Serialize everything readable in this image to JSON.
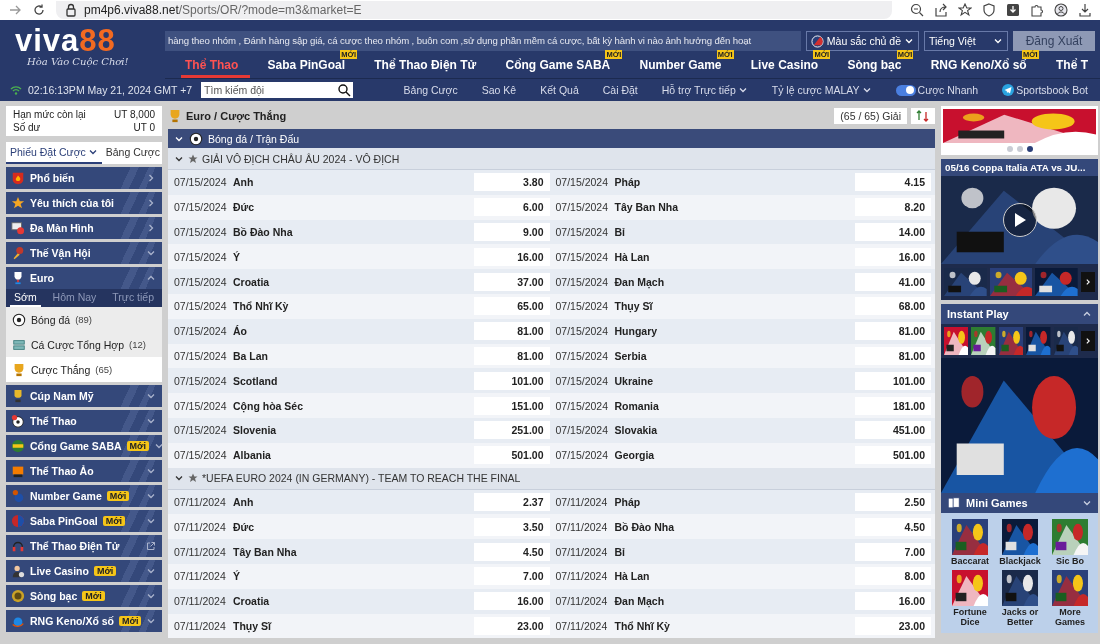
{
  "browser": {
    "url_host": "pm4p6.viva88.net",
    "url_path": "/Sports/OR/?mode=m3&market=E"
  },
  "header": {
    "logo": {
      "name": "viva",
      "number": "88",
      "tagline": "Hòa Vào Cuộc Chơi!"
    },
    "ticker": "hàng theo nhóm , Đánh hàng sập giá, cá cược theo nhóm , buôn com ,sử dụng phần mềm cá cược, bất kỳ hành vi nào ảnh hưởng đến hoạt",
    "theme_button": "Màu sắc chủ đề",
    "language": "Tiếng Việt",
    "logout": "Đăng Xuất",
    "nav": [
      {
        "label": "Thể Thao",
        "selected": true
      },
      {
        "label": "Saba PinGoal",
        "selected": false,
        "badge": "MỚI"
      },
      {
        "label": "Thể Thao Điện Tử",
        "selected": false
      },
      {
        "label": "Cổng Game SABA",
        "selected": false,
        "badge": "MỚI"
      },
      {
        "label": "Number Game",
        "selected": false,
        "badge": "MỚI"
      },
      {
        "label": "Live Casino",
        "selected": false,
        "badge": "MỚI"
      },
      {
        "label": "Sòng bạc",
        "selected": false,
        "badge": "MỚI"
      },
      {
        "label": "RNG Keno/Xổ số",
        "selected": false,
        "badge": "MỚI"
      },
      {
        "label": "Thể T",
        "selected": false
      }
    ]
  },
  "toolbar": {
    "clock": "02:16:13PM May 21, 2024 GMT +7",
    "search_placeholder": "Tìm kiếm đội",
    "links": [
      {
        "label": "Bảng Cược",
        "dropdown": false
      },
      {
        "label": "Sao Kê",
        "dropdown": false
      },
      {
        "label": "Kết Quả",
        "dropdown": false
      },
      {
        "label": "Cài Đặt",
        "dropdown": false
      },
      {
        "label": "Hỗ trợ Trực tiếp",
        "dropdown": true
      },
      {
        "label": "Tỷ lệ cược MALAY",
        "dropdown": true
      }
    ],
    "quick_bet": {
      "label": "Cược Nhanh",
      "on": true
    },
    "bot": "Sportsbook Bot"
  },
  "sidebar": {
    "balance": [
      {
        "label": "Hạn mức còn lại",
        "value": "UT 8,000"
      },
      {
        "label": "Số dư",
        "value": "UT 0"
      }
    ],
    "tabs": [
      {
        "label": "Phiếu Đặt Cược",
        "selected": true,
        "dropdown": true
      },
      {
        "label": "Bảng Cược",
        "selected": false,
        "dropdown": false
      }
    ],
    "menu": [
      {
        "label": "Phổ biến",
        "kind": "link"
      },
      {
        "label": "Yêu thích của tôi",
        "kind": "link"
      },
      {
        "label": "Đa Màn Hình",
        "kind": "link"
      },
      {
        "label": "Thế Vận Hội",
        "kind": "group",
        "expanded": false
      },
      {
        "label": "Euro",
        "kind": "group",
        "expanded": true,
        "subtabs": [
          {
            "label": "Sớm",
            "selected": true
          },
          {
            "label": "Hôm Nay",
            "selected": false
          },
          {
            "label": "Trực tiếp",
            "selected": false
          }
        ],
        "children": [
          {
            "label": "Bóng đá",
            "count": "(89)",
            "selected": false
          },
          {
            "label": "Cá Cược Tổng Hợp",
            "count": "(12)",
            "selected": false
          },
          {
            "label": "Cược Thắng",
            "count": "(65)",
            "selected": true
          }
        ]
      },
      {
        "label": "Cúp Nam Mỹ",
        "kind": "group",
        "expanded": false
      },
      {
        "label": "Thể Thao",
        "kind": "group",
        "expanded": false
      },
      {
        "label": "Cổng Game SABA",
        "kind": "group",
        "expanded": false,
        "badge": "Mới"
      },
      {
        "label": "Thể Thao Ảo",
        "kind": "group",
        "expanded": false
      },
      {
        "label": "Number Game",
        "kind": "group",
        "expanded": false,
        "badge": "Mới"
      },
      {
        "label": "Saba PinGoal",
        "kind": "group",
        "expanded": false,
        "badge": "Mới"
      },
      {
        "label": "Thể Thao Điện Tử",
        "kind": "external"
      },
      {
        "label": "Live Casino",
        "kind": "group",
        "expanded": false,
        "badge": "Mới"
      },
      {
        "label": "Sòng bạc",
        "kind": "group",
        "expanded": false,
        "badge": "Mới"
      },
      {
        "label": "RNG Keno/Xổ số",
        "kind": "group",
        "expanded": false,
        "badge": "Mới"
      }
    ]
  },
  "main": {
    "breadcrumb": "Euro / Cược Thắng",
    "league_count": "(65 / 65) Giải",
    "sport_header": "Bóng đá / Trận Đấu",
    "groups": [
      {
        "title": "GIẢI VÔ ĐỊCH CHÂU ÂU 2024 - VÔ ĐỊCH",
        "rows": [
          {
            "left": {
              "date": "07/15/2024",
              "team": "Anh",
              "odds": "3.80"
            },
            "right": {
              "date": "07/15/2024",
              "team": "Pháp",
              "odds": "4.15"
            }
          },
          {
            "left": {
              "date": "07/15/2024",
              "team": "Đức",
              "odds": "6.00"
            },
            "right": {
              "date": "07/15/2024",
              "team": "Tây Ban Nha",
              "odds": "8.20"
            }
          },
          {
            "left": {
              "date": "07/15/2024",
              "team": "Bồ Đào Nha",
              "odds": "9.00"
            },
            "right": {
              "date": "07/15/2024",
              "team": "Bỉ",
              "odds": "14.00"
            }
          },
          {
            "left": {
              "date": "07/15/2024",
              "team": "Ý",
              "odds": "16.00"
            },
            "right": {
              "date": "07/15/2024",
              "team": "Hà Lan",
              "odds": "16.00"
            }
          },
          {
            "left": {
              "date": "07/15/2024",
              "team": "Croatia",
              "odds": "37.00"
            },
            "right": {
              "date": "07/15/2024",
              "team": "Đan Mạch",
              "odds": "41.00"
            }
          },
          {
            "left": {
              "date": "07/15/2024",
              "team": "Thổ Nhĩ Kỳ",
              "odds": "65.00"
            },
            "right": {
              "date": "07/15/2024",
              "team": "Thụy Sĩ",
              "odds": "68.00"
            }
          },
          {
            "left": {
              "date": "07/15/2024",
              "team": "Áo",
              "odds": "81.00"
            },
            "right": {
              "date": "07/15/2024",
              "team": "Hungary",
              "odds": "81.00"
            }
          },
          {
            "left": {
              "date": "07/15/2024",
              "team": "Ba Lan",
              "odds": "81.00"
            },
            "right": {
              "date": "07/15/2024",
              "team": "Serbia",
              "odds": "81.00"
            }
          },
          {
            "left": {
              "date": "07/15/2024",
              "team": "Scotland",
              "odds": "101.00"
            },
            "right": {
              "date": "07/15/2024",
              "team": "Ukraine",
              "odds": "101.00"
            }
          },
          {
            "left": {
              "date": "07/15/2024",
              "team": "Cộng hòa Séc",
              "odds": "151.00"
            },
            "right": {
              "date": "07/15/2024",
              "team": "Romania",
              "odds": "181.00"
            }
          },
          {
            "left": {
              "date": "07/15/2024",
              "team": "Slovenia",
              "odds": "251.00"
            },
            "right": {
              "date": "07/15/2024",
              "team": "Slovakia",
              "odds": "451.00"
            }
          },
          {
            "left": {
              "date": "07/15/2024",
              "team": "Albania",
              "odds": "501.00"
            },
            "right": {
              "date": "07/15/2024",
              "team": "Georgia",
              "odds": "501.00"
            }
          }
        ]
      },
      {
        "title": "*UEFA EURO 2024 (IN GERMANY) - TEAM TO REACH THE FINAL",
        "rows": [
          {
            "left": {
              "date": "07/11/2024",
              "team": "Anh",
              "odds": "2.37"
            },
            "right": {
              "date": "07/11/2024",
              "team": "Pháp",
              "odds": "2.50"
            }
          },
          {
            "left": {
              "date": "07/11/2024",
              "team": "Đức",
              "odds": "3.50"
            },
            "right": {
              "date": "07/11/2024",
              "team": "Bồ Đào Nha",
              "odds": "4.50"
            }
          },
          {
            "left": {
              "date": "07/11/2024",
              "team": "Tây Ban Nha",
              "odds": "4.50"
            },
            "right": {
              "date": "07/11/2024",
              "team": "Bỉ",
              "odds": "7.00"
            }
          },
          {
            "left": {
              "date": "07/11/2024",
              "team": "Ý",
              "odds": "7.00"
            },
            "right": {
              "date": "07/11/2024",
              "team": "Hà Lan",
              "odds": "8.00"
            }
          },
          {
            "left": {
              "date": "07/11/2024",
              "team": "Croatia",
              "odds": "16.00"
            },
            "right": {
              "date": "07/11/2024",
              "team": "Đan Mạch",
              "odds": "16.00"
            }
          },
          {
            "left": {
              "date": "07/11/2024",
              "team": "Thụy Sĩ",
              "odds": "23.00"
            },
            "right": {
              "date": "07/11/2024",
              "team": "Thổ Nhĩ Kỳ",
              "odds": "23.00"
            }
          }
        ]
      }
    ]
  },
  "right": {
    "banner_dots": [
      {
        "selected": false
      },
      {
        "selected": false
      },
      {
        "selected": true
      }
    ],
    "video": {
      "title": "05/16 Coppa Italia ATA vs JU..."
    },
    "instant_play": {
      "title": "Instant Play"
    },
    "mini_games": {
      "title": "Mini Games",
      "games": [
        "Baccarat",
        "Blackjack",
        "Sic Bo",
        "Fortune Dice",
        "Jacks or Better",
        "More Games"
      ]
    }
  }
}
